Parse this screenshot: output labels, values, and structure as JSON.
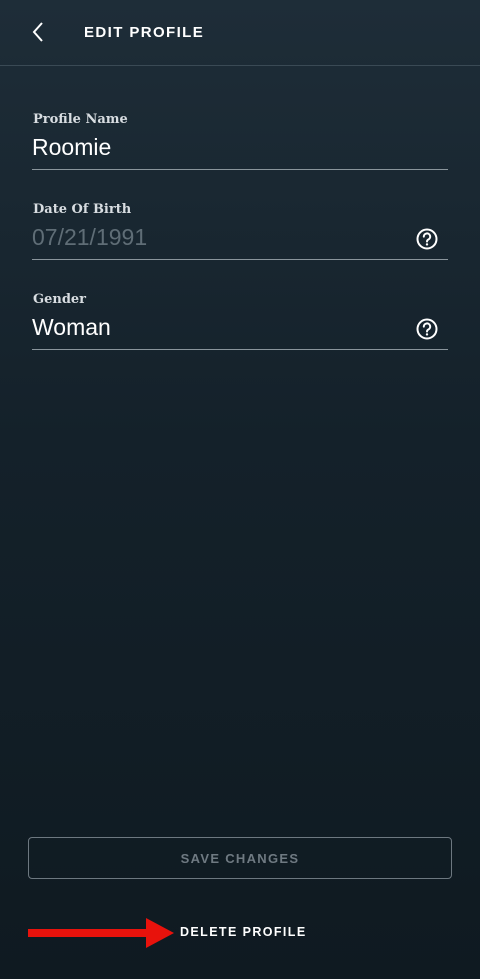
{
  "header": {
    "back_icon": "chevron-left-icon",
    "title": "EDIT PROFILE"
  },
  "fields": {
    "profile_name": {
      "label": "Profile Name",
      "value": "Roomie"
    },
    "date_of_birth": {
      "label": "Date Of Birth",
      "value": "07/21/1991",
      "help_icon": "question-circle-icon"
    },
    "gender": {
      "label": "Gender",
      "value": "Woman",
      "help_icon": "question-circle-icon"
    }
  },
  "actions": {
    "save_label": "SAVE CHANGES",
    "delete_label": "DELETE PROFILE"
  },
  "colors": {
    "background": "#14212a",
    "accent_arrow": "#e8120c",
    "disabled_text": "#6f7a82"
  }
}
